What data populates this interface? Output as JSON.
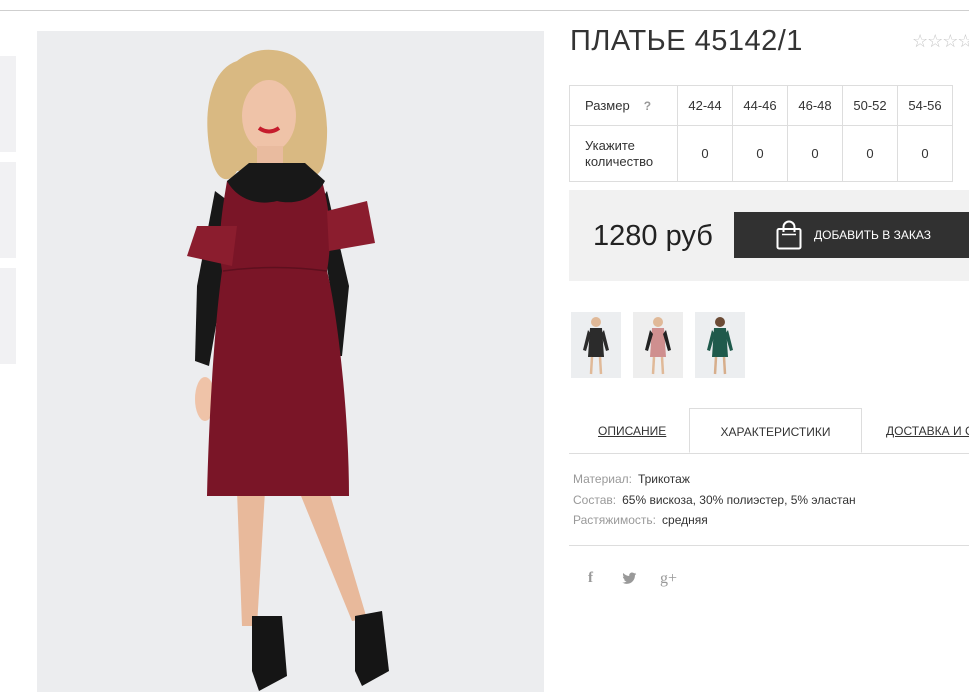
{
  "product": {
    "title": "ПЛАТЬЕ 45142/1",
    "rating_stars": "☆☆☆☆"
  },
  "sizes_table": {
    "size_label": "Размер",
    "help_mark": "?",
    "quantity_label": "Укажите количество",
    "sizes": [
      "42-44",
      "44-46",
      "46-48",
      "50-52",
      "54-56"
    ],
    "quantities": [
      "0",
      "0",
      "0",
      "0",
      "0"
    ]
  },
  "purchase": {
    "price": "1280 руб",
    "order_button": "ДОБАВИТЬ В ЗАКАЗ",
    "bag_icon": "shopping-bag-icon"
  },
  "thumbnails": [
    {
      "name": "thumb-black-dress",
      "color": "#2b2b2b"
    },
    {
      "name": "thumb-pink-dress",
      "color": "#cf8f8f"
    },
    {
      "name": "thumb-green-dress",
      "color": "#1f5a4c"
    }
  ],
  "main_image": {
    "dress_color": "#7a1527",
    "lace_color": "#181818",
    "background_color": "#ecedef"
  },
  "tabs": {
    "description": "ОПИСАНИЕ",
    "characteristics": "ХАРАКТЕРИСТИКИ",
    "delivery": "ДОСТАВКА И С"
  },
  "specs": [
    {
      "label": "Материал:",
      "value": "Трикотаж"
    },
    {
      "label": "Состав:",
      "value": "65% вискоза, 30% полиэстер, 5% эластан"
    },
    {
      "label": "Растяжимость:",
      "value": "средняя"
    }
  ],
  "social": {
    "facebook": "f",
    "twitter": "twitter-icon",
    "google_plus": "g+"
  }
}
